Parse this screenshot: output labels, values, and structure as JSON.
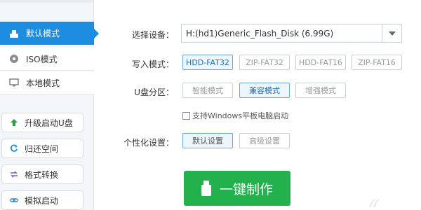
{
  "sidebar": {
    "modes": [
      {
        "label": "默认模式",
        "icon": "usb-drive-icon"
      },
      {
        "label": "ISO模式",
        "icon": "disc-icon"
      },
      {
        "label": "本地模式",
        "icon": "monitor-icon"
      }
    ],
    "tools": [
      {
        "label": "升级启动U盘",
        "icon": "upgrade-arrow-icon"
      },
      {
        "label": "归还空间",
        "icon": "restore-icon"
      },
      {
        "label": "格式转换",
        "icon": "convert-icon"
      },
      {
        "label": "模拟启动",
        "icon": "link-icon"
      }
    ]
  },
  "main": {
    "device_label": "选择设备：",
    "device_value": "H:(hd1)Generic_Flash_Disk (6.99G)",
    "write_mode_label": "写入模式：",
    "write_modes": [
      "HDD-FAT32",
      "ZIP-FAT32",
      "HDD-FAT16",
      "ZIP-FAT16"
    ],
    "partition_label": "U盘分区：",
    "partitions": [
      "智能模式",
      "兼容模式",
      "增强模式"
    ],
    "windows_tablet_checkbox": "支持Windows平板电脑启动",
    "personalize_label": "个性化设置：",
    "personalize_options": [
      "默认设置",
      "高级设置"
    ],
    "make_button": "一键制作"
  },
  "colors": {
    "accent": "#1c8de0",
    "make_button": "#22b14c"
  }
}
